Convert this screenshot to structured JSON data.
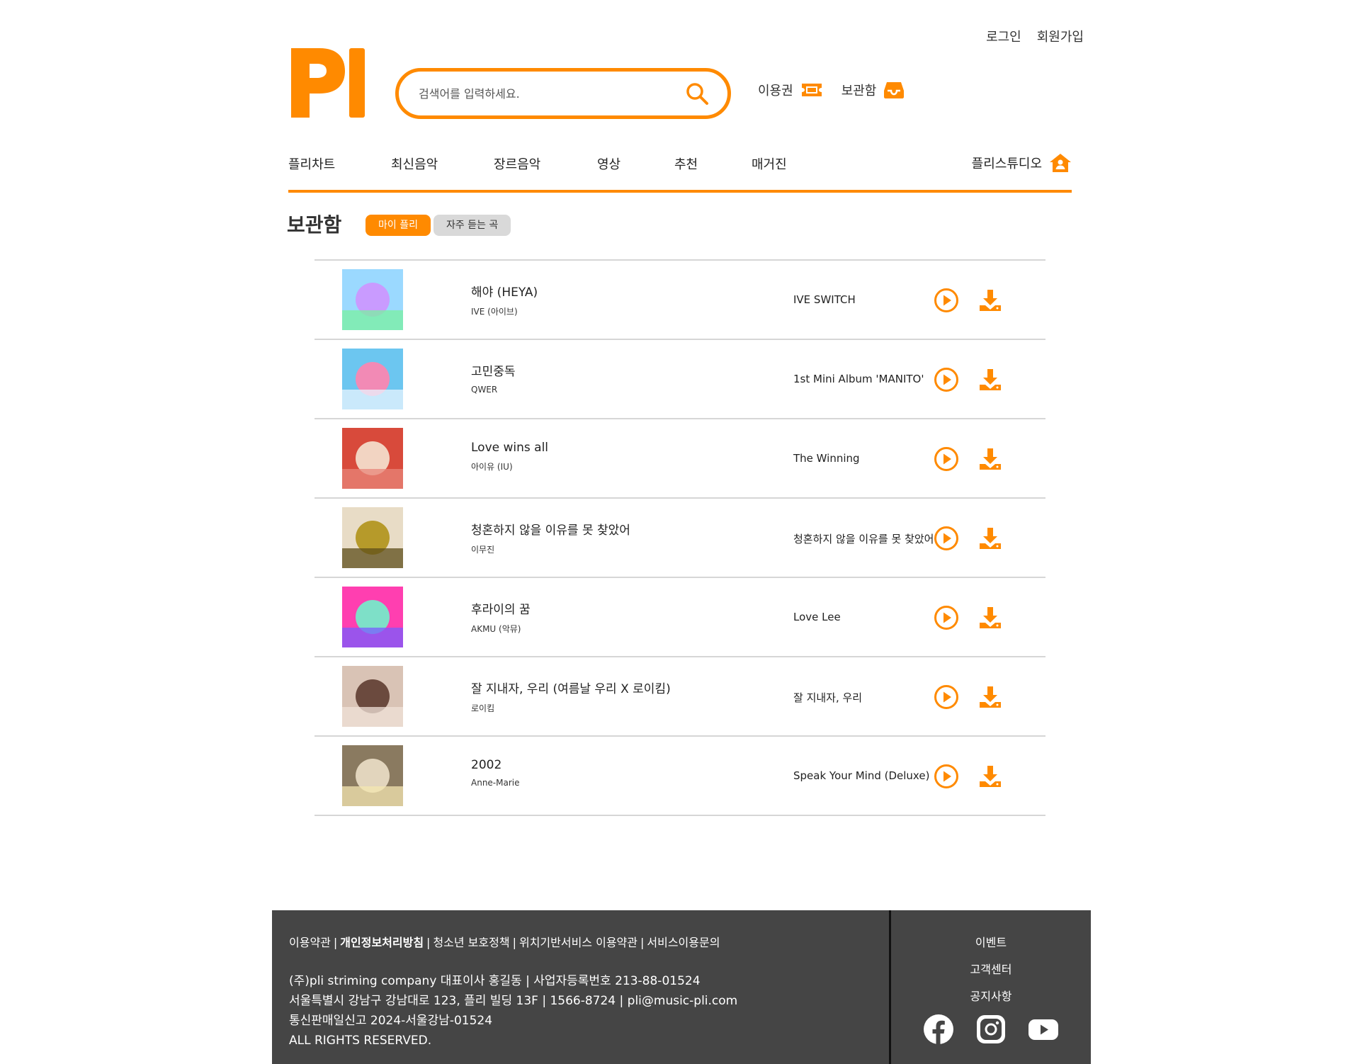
{
  "brand": {
    "logo_text": "PI",
    "accent": "#ff8a00"
  },
  "util": {
    "login": "로그인",
    "signup": "회원가입"
  },
  "search": {
    "placeholder": "검색어를 입력하세요."
  },
  "header_links": {
    "voucher": "이용권",
    "library": "보관함"
  },
  "nav": {
    "items": [
      "플리차트",
      "최신음악",
      "장르음악",
      "영상",
      "추천",
      "매거진"
    ],
    "studio": "플리스튜디오"
  },
  "page": {
    "title": "보관함",
    "tabs": [
      {
        "label": "마이 플리",
        "active": true
      },
      {
        "label": "자주 듣는 곡",
        "active": false
      }
    ]
  },
  "tracks": [
    {
      "title": "해야 (HEYA)",
      "artist": "IVE (아이브)",
      "album": "IVE SWITCH",
      "cover_colors": [
        "#9bd9ff",
        "#c99bff",
        "#7af0a0"
      ]
    },
    {
      "title": "고민중독",
      "artist": "QWER",
      "album": "1st Mini Album 'MANITO'",
      "cover_colors": [
        "#6cc6f0",
        "#f28ab5",
        "#e9f4ff"
      ]
    },
    {
      "title": "Love wins all",
      "artist": "아이유 (IU)",
      "album": "The Winning",
      "cover_colors": [
        "#d84a3b",
        "#f2d4c2",
        "#e8867a"
      ]
    },
    {
      "title": "청혼하지 않을 이유를 못 찾았어",
      "artist": "이무진",
      "album": "청혼하지 않을 이유를 못 찾았어",
      "cover_colors": [
        "#e8dcc6",
        "#b69a2a",
        "#5d4d1a"
      ]
    },
    {
      "title": "후라이의 꿈",
      "artist": "AKMU (악뮤)",
      "album": "Love Lee",
      "cover_colors": [
        "#ff3fb0",
        "#7ee0c8",
        "#7a5cff"
      ]
    },
    {
      "title": "잘 지내자, 우리 (여름날 우리 X 로이킴)",
      "artist": "로이킴",
      "album": "잘 지내자, 우리",
      "cover_colors": [
        "#d9c3b5",
        "#6b4a3e",
        "#efe2d8"
      ]
    },
    {
      "title": "2002",
      "artist": "Anne-Marie",
      "album": "Speak Your Mind (Deluxe)",
      "cover_colors": [
        "#8a7a60",
        "#e2d5bd",
        "#f3e6b0"
      ]
    }
  ],
  "footer": {
    "links": [
      "이용약관",
      "개인정보처리방침",
      "청소년 보호정책",
      "위치기반서비스 이용약관",
      "서비스이용문의"
    ],
    "info": [
      "(주)pli striming company 대표이사 홍길동 | 사업자등록번호 213-88-01524",
      "서울특별시 강남구 강남대로 123, 플리 빌딩 13F | 1566-8724 | pli@music-pli.com",
      "통신판매일신고 2024-서울강남-01524",
      "ALL RIGHTS RESERVED."
    ],
    "side_links": [
      "이벤트",
      "고객센터",
      "공지사항"
    ],
    "socials": [
      "facebook-icon",
      "instagram-icon",
      "youtube-icon"
    ]
  }
}
